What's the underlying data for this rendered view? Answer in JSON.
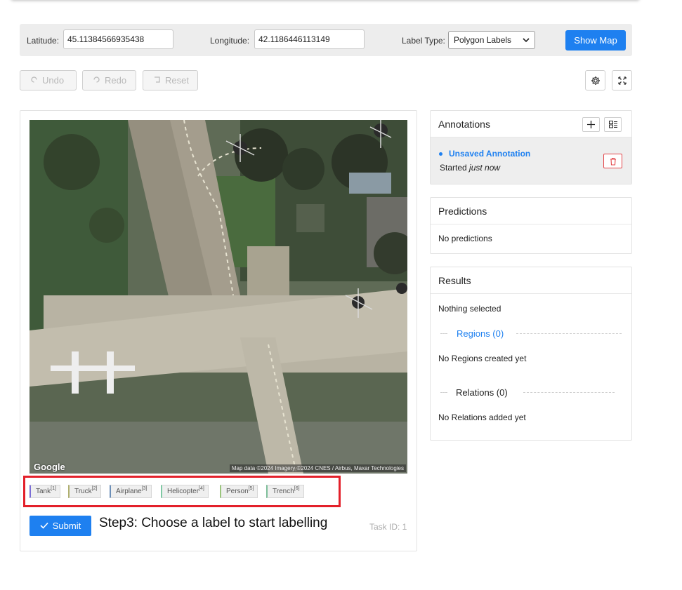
{
  "controls": {
    "latitude_label": "Latitude:",
    "latitude_value": "45.11384566935438",
    "longitude_label": "Longitude:",
    "longitude_value": "42.1186446113149",
    "label_type_label": "Label Type:",
    "label_type_value": "Polygon Labels",
    "show_map_label": "Show Map"
  },
  "toolbar": {
    "undo_label": "Undo",
    "redo_label": "Redo",
    "reset_label": "Reset"
  },
  "map": {
    "logo_text": "Google",
    "credit_text": "Map data ©2024 Imagery ©2024 CNES / Airbus, Maxar Technologies"
  },
  "labels": [
    {
      "name": "Tank",
      "hotkey": "[1]",
      "color": "#7b6ed6"
    },
    {
      "name": "Truck",
      "hotkey": "[2]",
      "color": "#b0b070"
    },
    {
      "name": "Airplane",
      "hotkey": "[3]",
      "color": "#6c8fb8"
    },
    {
      "name": "Helicopter",
      "hotkey": "[4]",
      "color": "#7fc9a4"
    },
    {
      "name": "Person",
      "hotkey": "[5]",
      "color": "#9ac57c"
    },
    {
      "name": "Trench",
      "hotkey": "[6]",
      "color": "#7ebf9a"
    }
  ],
  "submit_label": "Submit",
  "step_instruction": "Step3: Choose a label to start labelling",
  "task_id_text": "Task ID: 1",
  "annotations": {
    "title": "Annotations",
    "item_name": "Unsaved Annotation",
    "item_started_prefix": "Started ",
    "item_started_time": "just now"
  },
  "predictions": {
    "title": "Predictions",
    "empty_text": "No predictions"
  },
  "results": {
    "title": "Results",
    "selection_text": "Nothing selected",
    "regions_label": "Regions (0)",
    "regions_empty": "No Regions created yet",
    "relations_label": "Relations (0)",
    "relations_empty": "No Relations added yet"
  },
  "colors": {
    "primary": "#1e80f0",
    "highlight": "#e3202a",
    "danger": "#e3474b"
  }
}
